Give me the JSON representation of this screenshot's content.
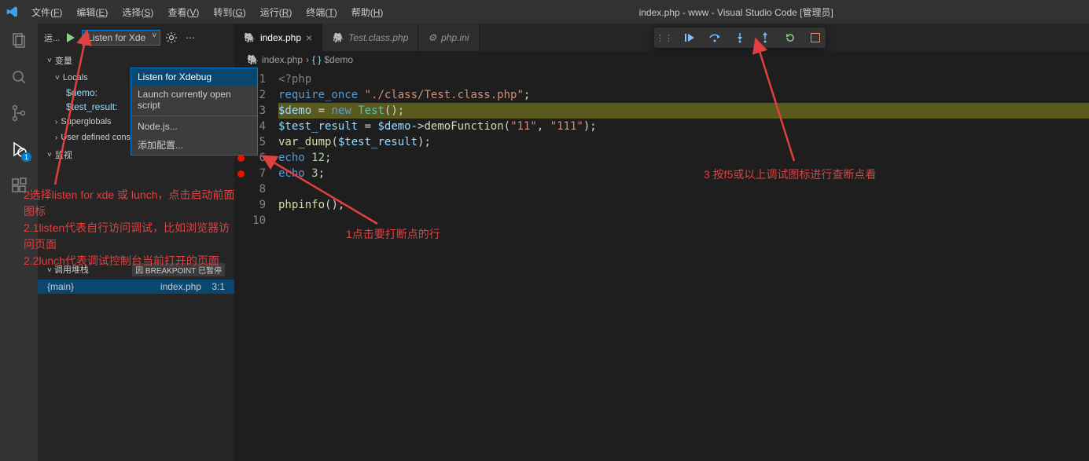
{
  "title": "index.php - www - Visual Studio Code [管理员]",
  "menu": [
    {
      "label": "文件",
      "key": "F"
    },
    {
      "label": "编辑",
      "key": "E"
    },
    {
      "label": "选择",
      "key": "S"
    },
    {
      "label": "查看",
      "key": "V"
    },
    {
      "label": "转到",
      "key": "G"
    },
    {
      "label": "运行",
      "key": "R"
    },
    {
      "label": "终端",
      "key": "T"
    },
    {
      "label": "帮助",
      "key": "H"
    }
  ],
  "sidebar": {
    "run_label": "运...",
    "config_selected": "Listen for Xde",
    "dropdown": [
      "Listen for Xdebug",
      "Launch currently open script",
      "Node.js...",
      "添加配置..."
    ],
    "sections": {
      "variables": "变量",
      "locals": "Locals",
      "superglobals": "Superglobals",
      "userconst": "User defined constants",
      "watch": "监视",
      "callstack": "调用堆栈",
      "callstack_tag": "因 BREAKPOINT 已暂停"
    },
    "local_vars": [
      {
        "name": "$demo:",
        "value": ""
      },
      {
        "name": "$test_result:",
        "value": ""
      }
    ],
    "callstack_item": {
      "name": "{main}",
      "file": "index.php",
      "loc": "3:1"
    }
  },
  "tabs": [
    {
      "label": "index.php",
      "icon": "elephant",
      "active": true,
      "close": true
    },
    {
      "label": "Test.class.php",
      "icon": "elephant",
      "active": false,
      "italic": true
    },
    {
      "label": "php.ini",
      "icon": "gear",
      "active": false,
      "italic": true
    }
  ],
  "breadcrumb": {
    "file": "index.php",
    "symbol": "$demo"
  },
  "code": {
    "lines": [
      {
        "n": 1,
        "html": "<span class='tk-tag'>&lt;?php</span>"
      },
      {
        "n": 2,
        "html": "<span class='tk-keyword'>require_once</span> <span class='tk-string'>\"./class/Test.class.php\"</span><span class='tk-punct'>;</span>"
      },
      {
        "n": 3,
        "bp": true,
        "current": true,
        "html": "<span class='tk-var'>$demo</span> <span class='tk-punct'>=</span> <span class='tk-keyword'>new</span> <span class='tk-class'>Test</span><span class='tk-punct'>();</span>"
      },
      {
        "n": 4,
        "bp": true,
        "html": "<span class='tk-var'>$test_result</span> <span class='tk-punct'>=</span> <span class='tk-var'>$demo</span><span class='tk-punct'>-&gt;</span><span class='tk-func'>demoFunction</span><span class='tk-punct'>(</span><span class='tk-string'>\"11\"</span><span class='tk-punct'>, </span><span class='tk-string'>\"111\"</span><span class='tk-punct'>);</span>"
      },
      {
        "n": 5,
        "bp": true,
        "html": "<span class='tk-func'>var_dump</span><span class='tk-punct'>(</span><span class='tk-var'>$test_result</span><span class='tk-punct'>);</span>"
      },
      {
        "n": 6,
        "bp": true,
        "html": "<span class='tk-keyword'>echo</span> <span class='tk-num'>12</span><span class='tk-punct'>;</span>"
      },
      {
        "n": 7,
        "bp": true,
        "html": "<span class='tk-keyword'>echo</span> <span class='tk-num'>3</span><span class='tk-punct'>;</span>"
      },
      {
        "n": 8,
        "html": ""
      },
      {
        "n": 9,
        "html": "<span class='tk-func'>phpinfo</span><span class='tk-punct'>();</span>"
      },
      {
        "n": 10,
        "html": ""
      }
    ]
  },
  "annotations": {
    "a1": "1点击要打断点的行",
    "a2_l1": "2选择listen for xde 或 lunch，点击启动前面图标",
    "a2_l2": "2.1listen代表自行访问调试，比如浏览器访问页面",
    "a2_l3": "2.2lunch代表调试控制台当前打开的页面",
    "a3": "3 按f5或以上调试图标进行查断点看"
  },
  "debug_badge": "1"
}
